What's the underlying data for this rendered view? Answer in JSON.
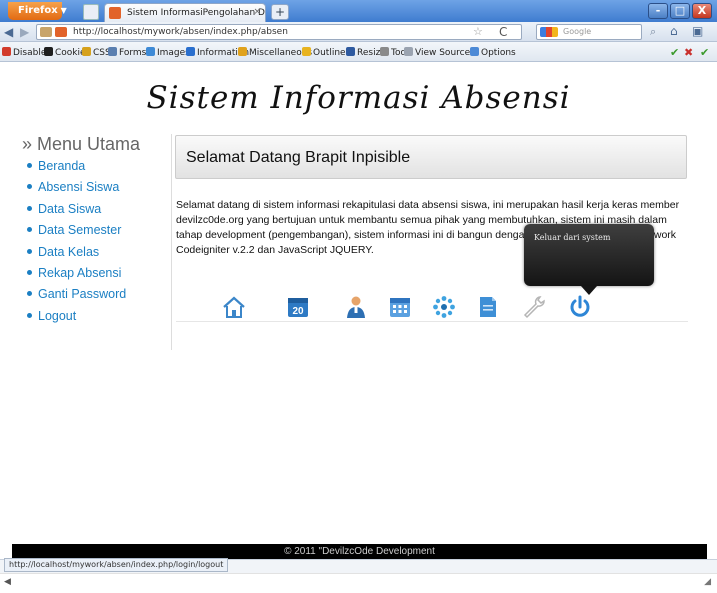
{
  "browser": {
    "app_button": "Firefox",
    "tab_title": "Sistem InformasiPengolahan Data Absen...",
    "tab_close": "×",
    "new_tab": "+",
    "url": "http://localhost/mywork/absen/index.php/absen",
    "search_placeholder": "Google",
    "window_min": "-",
    "window_max": "□",
    "window_close": "X"
  },
  "devbar": {
    "items": [
      {
        "label": "Disable",
        "color": "#d23b2b"
      },
      {
        "label": "Cookies",
        "color": "#1e1e1e"
      },
      {
        "label": "CSS",
        "color": "#d6a11c"
      },
      {
        "label": "Forms",
        "color": "#5a7fb0"
      },
      {
        "label": "Images",
        "color": "#3e8ad6"
      },
      {
        "label": "Information",
        "color": "#2a6fce"
      },
      {
        "label": "Miscellaneous",
        "color": "#e0a21c"
      },
      {
        "label": "Outline",
        "color": "#e8b31f"
      },
      {
        "label": "Resize",
        "color": "#2e5aa0"
      },
      {
        "label": "Tools",
        "color": "#8a8a8a"
      },
      {
        "label": "View Source",
        "color": "#9aa3b0"
      },
      {
        "label": "Options",
        "color": "#4d8ad6"
      }
    ]
  },
  "page": {
    "site_title": "Sistem Informasi Absensi",
    "menu_heading": "» Menu Utama",
    "menu": [
      "Beranda",
      "Absensi Siswa",
      "Data Siswa",
      "Data Semester",
      "Data Kelas",
      "Rekap Absensi",
      "Ganti Password",
      "Logout"
    ],
    "header": "Selamat Datang Brapit Inpisible",
    "welcome_text": "Selamat datang di sistem informasi rekapitulasi data absensi siswa, ini merupakan hasil kerja keras member devilzc0de.org yang bertujuan untuk membantu semua pihak yang membutuhkan, sistem ini masih dalam tahap development (pengembangan), sistem informasi ini di bangun dengan menggunakan PHP framework Codeigniter v.2.2 dan JavaScript JQUERY.",
    "tooltip": "Keluar dari system",
    "icons": [
      "home-icon",
      "calendar-icon",
      "user-icon",
      "schedule-icon",
      "settings-icon",
      "document-icon",
      "wrench-icon",
      "power-icon"
    ],
    "calendar_day": "20",
    "footer": "© 2011 \"DevilzcOde Development"
  },
  "status": {
    "url": "http://localhost/mywork/absen/index.php/login/logout"
  }
}
